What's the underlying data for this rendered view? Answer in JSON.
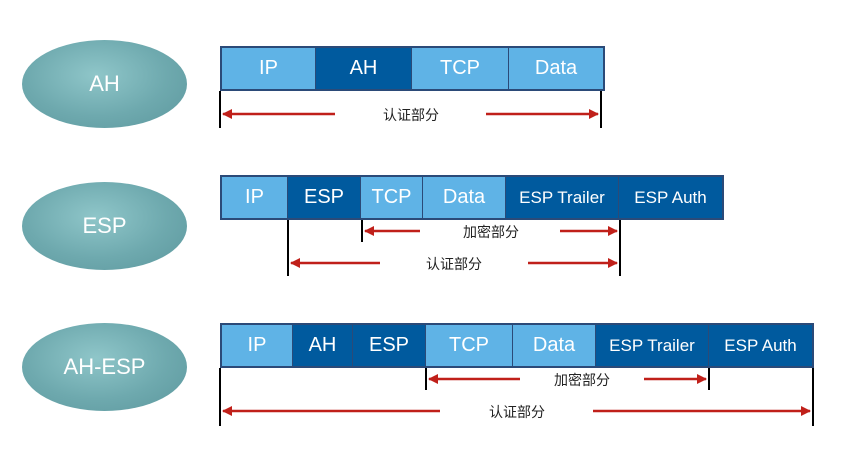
{
  "modes": [
    {
      "name": "AH",
      "fields": [
        {
          "label": "IP",
          "style": "light"
        },
        {
          "label": "AH",
          "style": "dark"
        },
        {
          "label": "TCP",
          "style": "light"
        },
        {
          "label": "Data",
          "style": "light"
        }
      ],
      "ranges": [
        {
          "label": "认证部分"
        }
      ]
    },
    {
      "name": "ESP",
      "fields": [
        {
          "label": "IP",
          "style": "light"
        },
        {
          "label": "ESP",
          "style": "dark"
        },
        {
          "label": "TCP",
          "style": "light"
        },
        {
          "label": "Data",
          "style": "light"
        },
        {
          "label": "ESP Trailer",
          "style": "dark"
        },
        {
          "label": "ESP Auth",
          "style": "dark"
        }
      ],
      "ranges": [
        {
          "label": "加密部分"
        },
        {
          "label": "认证部分"
        }
      ]
    },
    {
      "name": "AH-ESP",
      "fields": [
        {
          "label": "IP",
          "style": "light"
        },
        {
          "label": "AH",
          "style": "dark"
        },
        {
          "label": "ESP",
          "style": "dark"
        },
        {
          "label": "TCP",
          "style": "light"
        },
        {
          "label": "Data",
          "style": "light"
        },
        {
          "label": "ESP Trailer",
          "style": "dark"
        },
        {
          "label": "ESP Auth",
          "style": "dark"
        }
      ],
      "ranges": [
        {
          "label": "加密部分"
        },
        {
          "label": "认证部分"
        }
      ]
    }
  ],
  "colors": {
    "light_field": "#5fb3e6",
    "dark_field": "#005a9e",
    "ellipse": "#6ea9ae",
    "arrow": "#c0201a",
    "bracket": "#000000"
  }
}
